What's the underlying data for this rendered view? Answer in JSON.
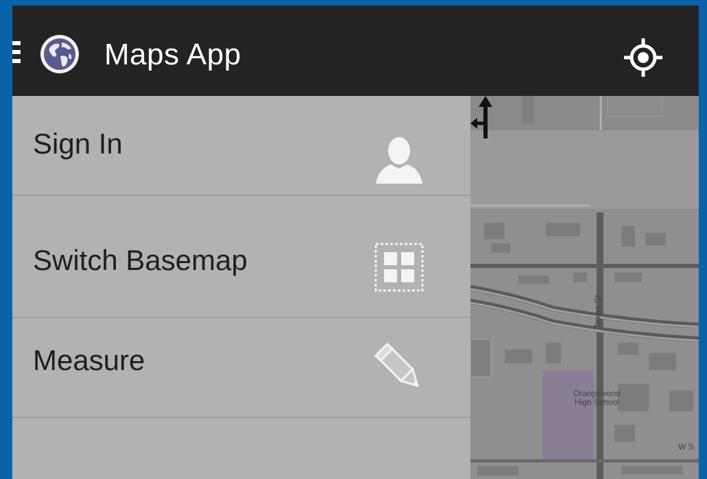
{
  "app": {
    "title": "Maps App"
  },
  "menu": {
    "items": [
      {
        "label": "Sign In",
        "icon": "user-icon"
      },
      {
        "label": "Switch Basemap",
        "icon": "basemap-grid-icon"
      },
      {
        "label": "Measure",
        "icon": "pencil-icon"
      }
    ]
  },
  "map": {
    "street_label": "Texas St",
    "school_label": "Orangewood\nHigh School",
    "corner_label": "W S"
  },
  "colors": {
    "app_bar": "#232323",
    "drawer": "#b2b2b2",
    "map_background": "#8f8f8f",
    "frame": "#0a63a8"
  }
}
